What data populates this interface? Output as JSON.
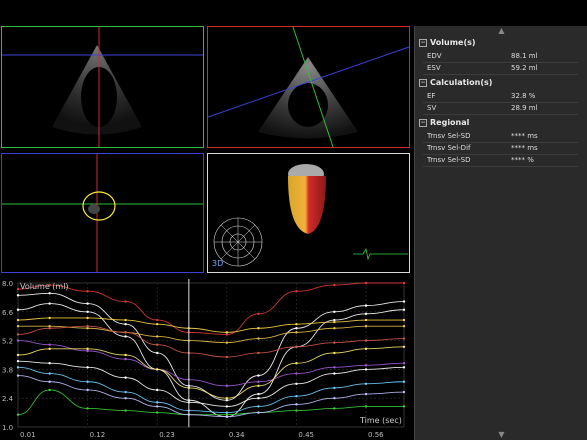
{
  "views": {
    "label_3d": "3D"
  },
  "panel": {
    "sections": [
      {
        "title": "Volume(s)",
        "rows": [
          {
            "label": "EDV",
            "value": "88.1 ml"
          },
          {
            "label": "ESV",
            "value": "59.2 ml"
          }
        ]
      },
      {
        "title": "Calculation(s)",
        "rows": [
          {
            "label": "EF",
            "value": "32.8 %"
          },
          {
            "label": "SV",
            "value": "28.9 ml"
          }
        ]
      },
      {
        "title": "Regional",
        "rows": [
          {
            "label": "Trnsv Sel-SD",
            "value": "**** ms"
          },
          {
            "label": "Trnsv Sel-Dif",
            "value": "**** ms"
          },
          {
            "label": "Trnsv Sel-SD",
            "value": "**** %"
          }
        ]
      }
    ],
    "expand_glyph": "−",
    "scroll_up": "▲",
    "scroll_down": "▼"
  },
  "chart_data": {
    "type": "line",
    "ylabel": "Volume (ml)",
    "xlabel": "Time (sec)",
    "x_ticks": [
      "0.01",
      "0.12",
      "0.23",
      "0.34",
      "0.45",
      "0.56"
    ],
    "y_ticks": [
      "1.0",
      "2.4",
      "3.8",
      "5.2",
      "6.6",
      "8.0"
    ],
    "xlim": [
      0.01,
      0.62
    ],
    "ylim": [
      1.0,
      8.0
    ],
    "cursor_x": 0.28,
    "grid": true,
    "x": [
      0.01,
      0.06,
      0.12,
      0.18,
      0.23,
      0.28,
      0.34,
      0.39,
      0.45,
      0.51,
      0.56,
      0.62
    ],
    "series": [
      {
        "color": "#e03a3a",
        "values": [
          7.7,
          7.9,
          7.6,
          7.1,
          6.2,
          5.6,
          5.5,
          6.5,
          7.6,
          7.9,
          8.0,
          8.0
        ]
      },
      {
        "color": "#ffffff",
        "values": [
          7.4,
          7.5,
          7.0,
          6.0,
          4.6,
          3.0,
          2.3,
          3.5,
          5.8,
          6.6,
          6.9,
          7.1
        ]
      },
      {
        "color": "#ffffff",
        "values": [
          6.7,
          7.0,
          6.6,
          5.4,
          3.8,
          2.3,
          1.5,
          2.6,
          4.9,
          6.2,
          6.5,
          6.7
        ]
      },
      {
        "color": "#ffd84a",
        "values": [
          6.2,
          6.3,
          6.3,
          6.2,
          6.0,
          5.8,
          5.6,
          5.8,
          6.0,
          6.1,
          6.2,
          6.2
        ]
      },
      {
        "color": "#e8c24a",
        "values": [
          5.9,
          5.9,
          5.8,
          5.6,
          5.4,
          5.2,
          5.1,
          5.3,
          5.6,
          5.8,
          5.9,
          5.9
        ]
      },
      {
        "color": "#d0584a",
        "values": [
          5.5,
          5.8,
          5.9,
          5.6,
          5.0,
          4.6,
          4.4,
          4.6,
          4.9,
          5.1,
          5.2,
          5.3
        ]
      },
      {
        "color": "#a35ad8",
        "values": [
          5.2,
          5.0,
          4.7,
          4.3,
          3.8,
          3.3,
          3.0,
          3.2,
          3.6,
          3.9,
          4.0,
          4.1
        ]
      },
      {
        "color": "#ffeb6a",
        "values": [
          4.5,
          4.8,
          4.8,
          4.5,
          3.8,
          2.9,
          2.4,
          3.0,
          4.1,
          4.6,
          4.8,
          4.9
        ]
      },
      {
        "color": "#ffffff",
        "values": [
          4.2,
          4.1,
          3.9,
          3.4,
          2.8,
          2.2,
          2.0,
          2.4,
          3.1,
          3.6,
          3.8,
          3.9
        ]
      },
      {
        "color": "#6fd0ff",
        "values": [
          3.9,
          3.6,
          3.2,
          2.7,
          2.2,
          1.8,
          1.7,
          2.0,
          2.5,
          2.9,
          3.1,
          3.2
        ]
      },
      {
        "color": "#3ad13a",
        "values": [
          1.6,
          2.8,
          1.9,
          1.8,
          1.7,
          1.6,
          1.6,
          1.7,
          1.8,
          1.9,
          2.0,
          2.0
        ]
      },
      {
        "color": "#c0c0ff",
        "values": [
          3.5,
          3.2,
          2.8,
          2.4,
          2.0,
          1.6,
          1.5,
          1.7,
          2.1,
          2.4,
          2.6,
          2.7
        ]
      }
    ]
  }
}
